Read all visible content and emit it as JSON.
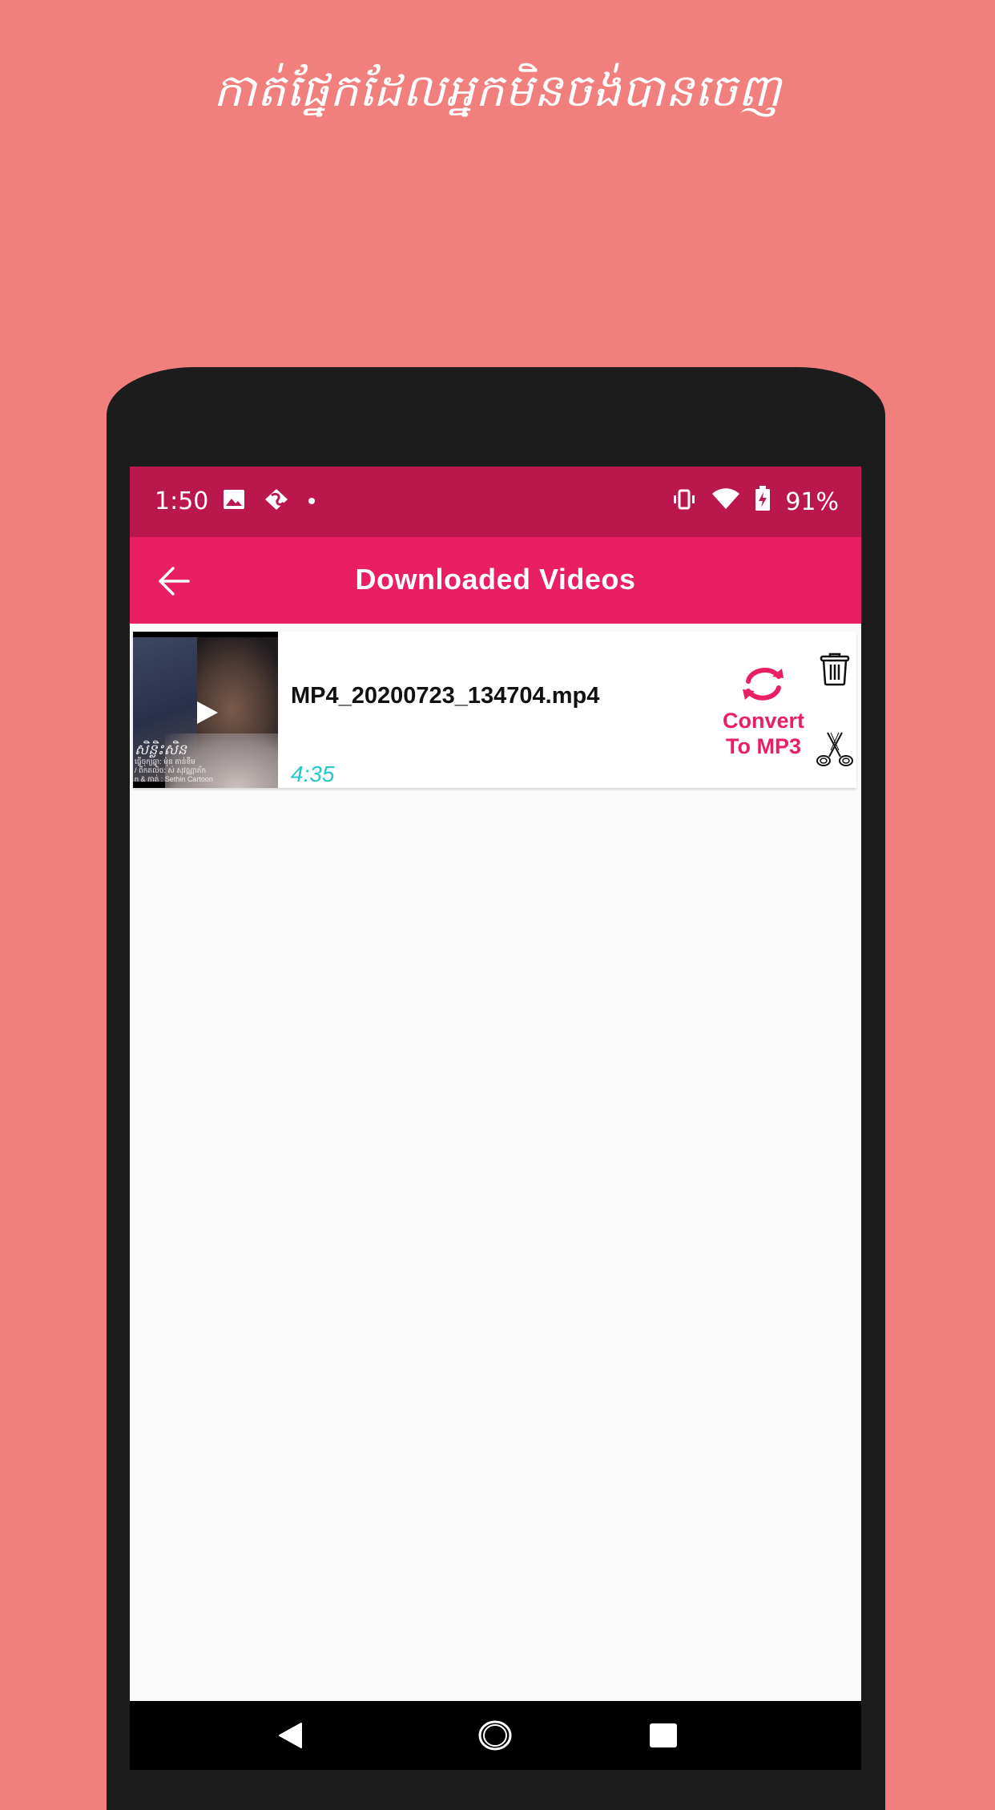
{
  "promo": {
    "headline": "កាត់ផ្នែកដែលអ្នកមិនចង់បានចេញ"
  },
  "status_bar": {
    "time": "1:50",
    "left_icons": [
      "image-icon",
      "app-notification-icon",
      "dot-icon"
    ],
    "right_icons": [
      "vibrate-icon",
      "wifi-icon",
      "battery-charging-icon"
    ],
    "battery": "91%"
  },
  "app_bar": {
    "back_icon": "arrow-left-icon",
    "title": "Downloaded Videos"
  },
  "videos": [
    {
      "file_name": "MP4_20200723_134704.mp4",
      "duration": "4:35",
      "thumbnail_caption_title": "សិន្លិះសិន",
      "thumbnail_caption_lines": [
        "ធ្វើចុក្យឆ្នា: ម៉ុន តាន់ខឹម",
        "/ ពីកតលិច: ស់ សុវណ្ណាភ័ក",
        "n & កាត់ : Sethin Cartoon"
      ],
      "convert_label_line1": "Convert",
      "convert_label_line2": "To MP3",
      "actions": [
        "convert-icon",
        "trash-icon",
        "scissors-icon"
      ]
    }
  ],
  "nav_bar": {
    "buttons": [
      "back",
      "home",
      "recents"
    ]
  },
  "colors": {
    "background": "#F07F7E",
    "status_bar": "#BA174D",
    "app_bar": "#E91E63",
    "accent": "#E91E63",
    "duration": "#26C6C6"
  }
}
